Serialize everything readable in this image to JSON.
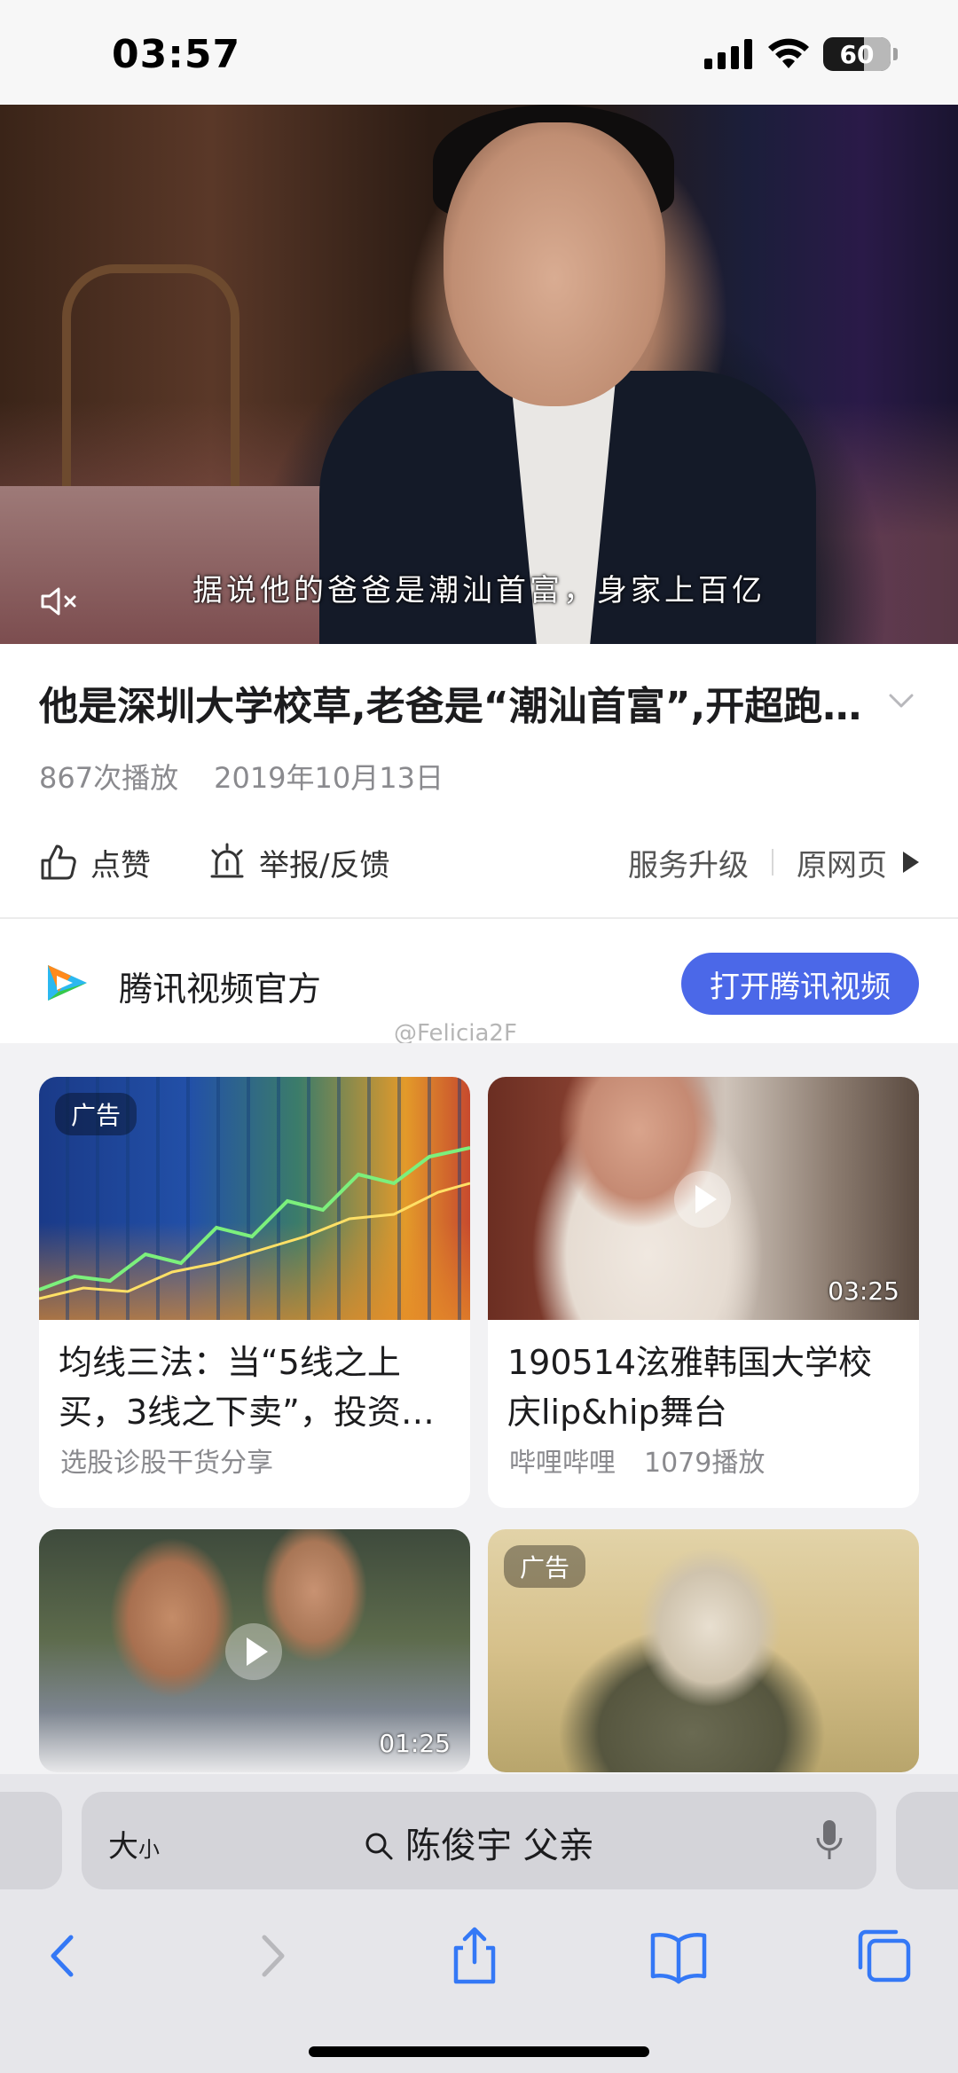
{
  "status_bar": {
    "time": "03:57",
    "battery": "60"
  },
  "video": {
    "subtitle": "据说他的爸爸是潮汕首富，身家上百亿",
    "title": "他是深圳大学校草,老爸是“潮汕首富”,开超跑…",
    "views": "867次播放",
    "date": "2019年10月13日"
  },
  "actions": {
    "like": "点赞",
    "report": "举报/反馈",
    "upgrade": "服务升级",
    "original": "原网页"
  },
  "channel": {
    "name": "腾讯视频官方",
    "open_button": "打开腾讯视频"
  },
  "watermark": "@Felicia2F",
  "feed": [
    {
      "tag": "广告",
      "title": "均线三法：当“5线之上买，3线之下卖”，投资…",
      "source": "选股诊股干货分享",
      "plays": "",
      "duration": ""
    },
    {
      "tag": "",
      "title": "190514泫雅韩国大学校庆lip&hip舞台",
      "source": "哔哩哔哩",
      "plays": "1079播放",
      "duration": "03:25"
    },
    {
      "tag": "",
      "title": "",
      "source": "",
      "plays": "",
      "duration": "01:25"
    },
    {
      "tag": "广告",
      "title": "",
      "source": "",
      "plays": "",
      "duration": ""
    }
  ],
  "browser": {
    "text_size_big": "大",
    "text_size_small": "小",
    "address": "陈俊宇 父亲"
  },
  "icons": {
    "mute": "mute-icon",
    "expand": "chevron-down-icon",
    "like": "thumbs-up-icon",
    "report": "alarm-icon",
    "channel": "tencent-video-logo",
    "back": "back-arrow-icon",
    "forward": "forward-arrow-icon",
    "share": "share-icon",
    "bookmarks": "book-icon",
    "tabs": "tabs-icon"
  },
  "colors": {
    "accent": "#4b68e8",
    "browser_blue": "#3478f6"
  }
}
